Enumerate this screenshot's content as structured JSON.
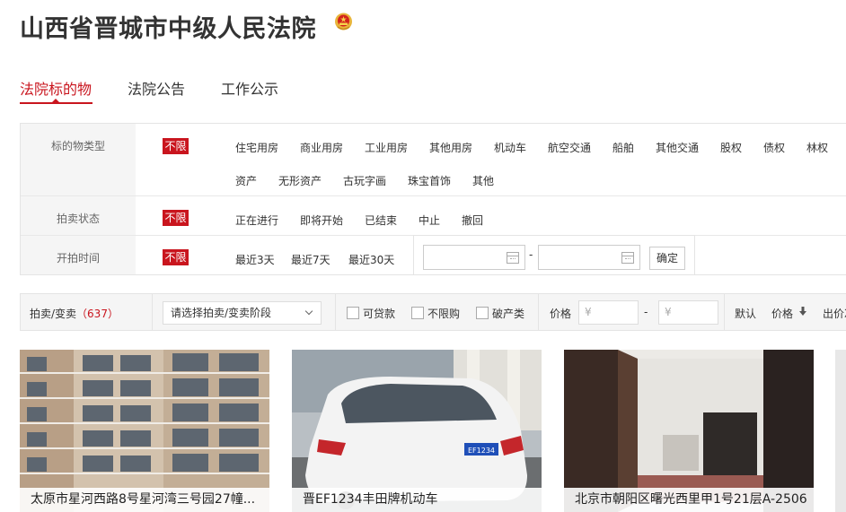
{
  "header": {
    "court_name": "山西省晋城市中级人民法院",
    "emblem_icon": "court-emblem-icon"
  },
  "tabs": [
    {
      "label": "法院标的物",
      "active": true
    },
    {
      "label": "法院公告",
      "active": false
    },
    {
      "label": "工作公示",
      "active": false
    }
  ],
  "filters": {
    "type": {
      "label": "标的物类型",
      "all": "不限",
      "options": [
        "住宅用房",
        "商业用房",
        "工业用房",
        "其他用房",
        "机动车",
        "航空交通",
        "船舶",
        "其他交通",
        "股权",
        "债权",
        "林权",
        "资产",
        "无形资产",
        "古玩字画",
        "珠宝首饰",
        "其他"
      ]
    },
    "status": {
      "label": "拍卖状态",
      "all": "不限",
      "options": [
        "正在进行",
        "即将开始",
        "已结束",
        "中止",
        "撤回"
      ]
    },
    "time": {
      "label": "开拍时间",
      "all": "不限",
      "options": [
        "最近3天",
        "最近7天",
        "最近30天"
      ],
      "date_separator": "-",
      "confirm_label": "确定"
    }
  },
  "sort_bar": {
    "title": "拍卖/变卖",
    "count": "（637）",
    "stage_select": "请选择拍卖/变卖阶段",
    "checkboxes": [
      "可贷款",
      "不限购",
      "破产类"
    ],
    "price_label": "价格",
    "price_min_placeholder": "¥",
    "price_dash": "-",
    "price_max_placeholder": "¥",
    "sort_default": "默认",
    "sort_price": "价格",
    "sort_bids": "出价次"
  },
  "cards": [
    {
      "caption": "太原市星河西路8号星河湾三号园27幢..."
    },
    {
      "caption": "晋EF1234丰田牌机动车"
    },
    {
      "caption": "北京市朝阳区曙光西里甲1号21层A-2506"
    }
  ],
  "colors": {
    "accent": "#c9151e",
    "panel": "#f5f5f5"
  }
}
